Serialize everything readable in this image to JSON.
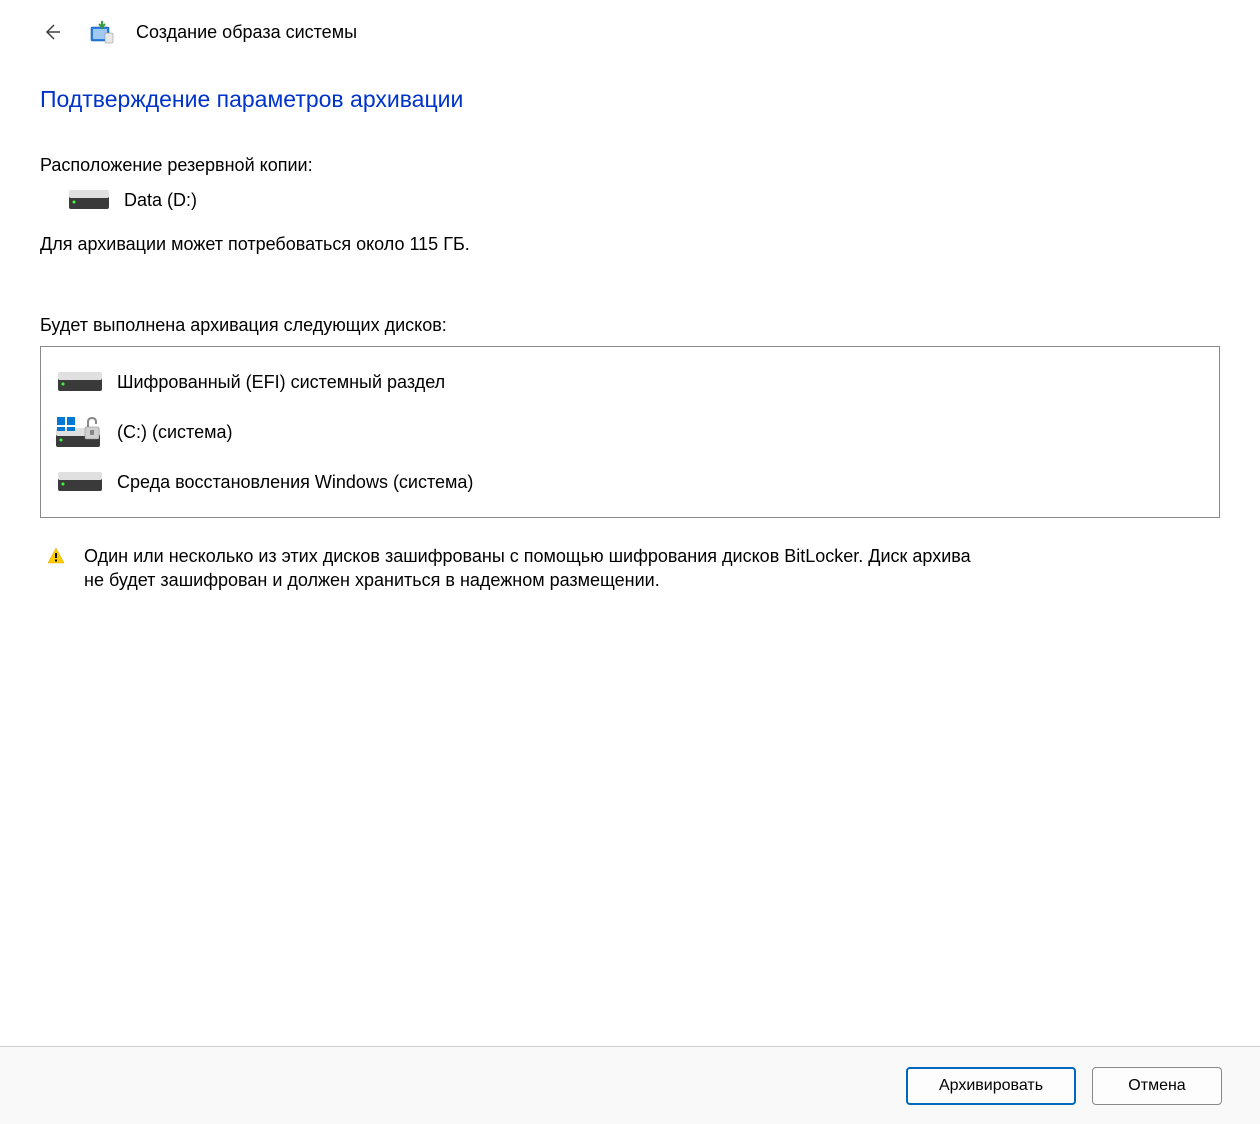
{
  "header": {
    "window_title": "Создание образа системы"
  },
  "page": {
    "heading": "Подтверждение параметров архивации",
    "location_label": "Расположение резервной копии:",
    "backup_location": "Data (D:)",
    "size_estimate": "Для архивации может потребоваться около 115 ГБ.",
    "drives_label": "Будет выполнена архивация следующих дисков:",
    "drives": [
      {
        "icon": "drive",
        "label": "Шифрованный (EFI) системный раздел"
      },
      {
        "icon": "drive-locked",
        "label": "(C:) (система)"
      },
      {
        "icon": "drive",
        "label": "Среда восстановления Windows (система)"
      }
    ],
    "warning_text": "Один или несколько из этих дисков зашифрованы с помощью шифрования дисков BitLocker. Диск архива не будет зашифрован и должен храниться в надежном размещении."
  },
  "footer": {
    "primary_button": "Архивировать",
    "cancel_button": "Отмена"
  }
}
